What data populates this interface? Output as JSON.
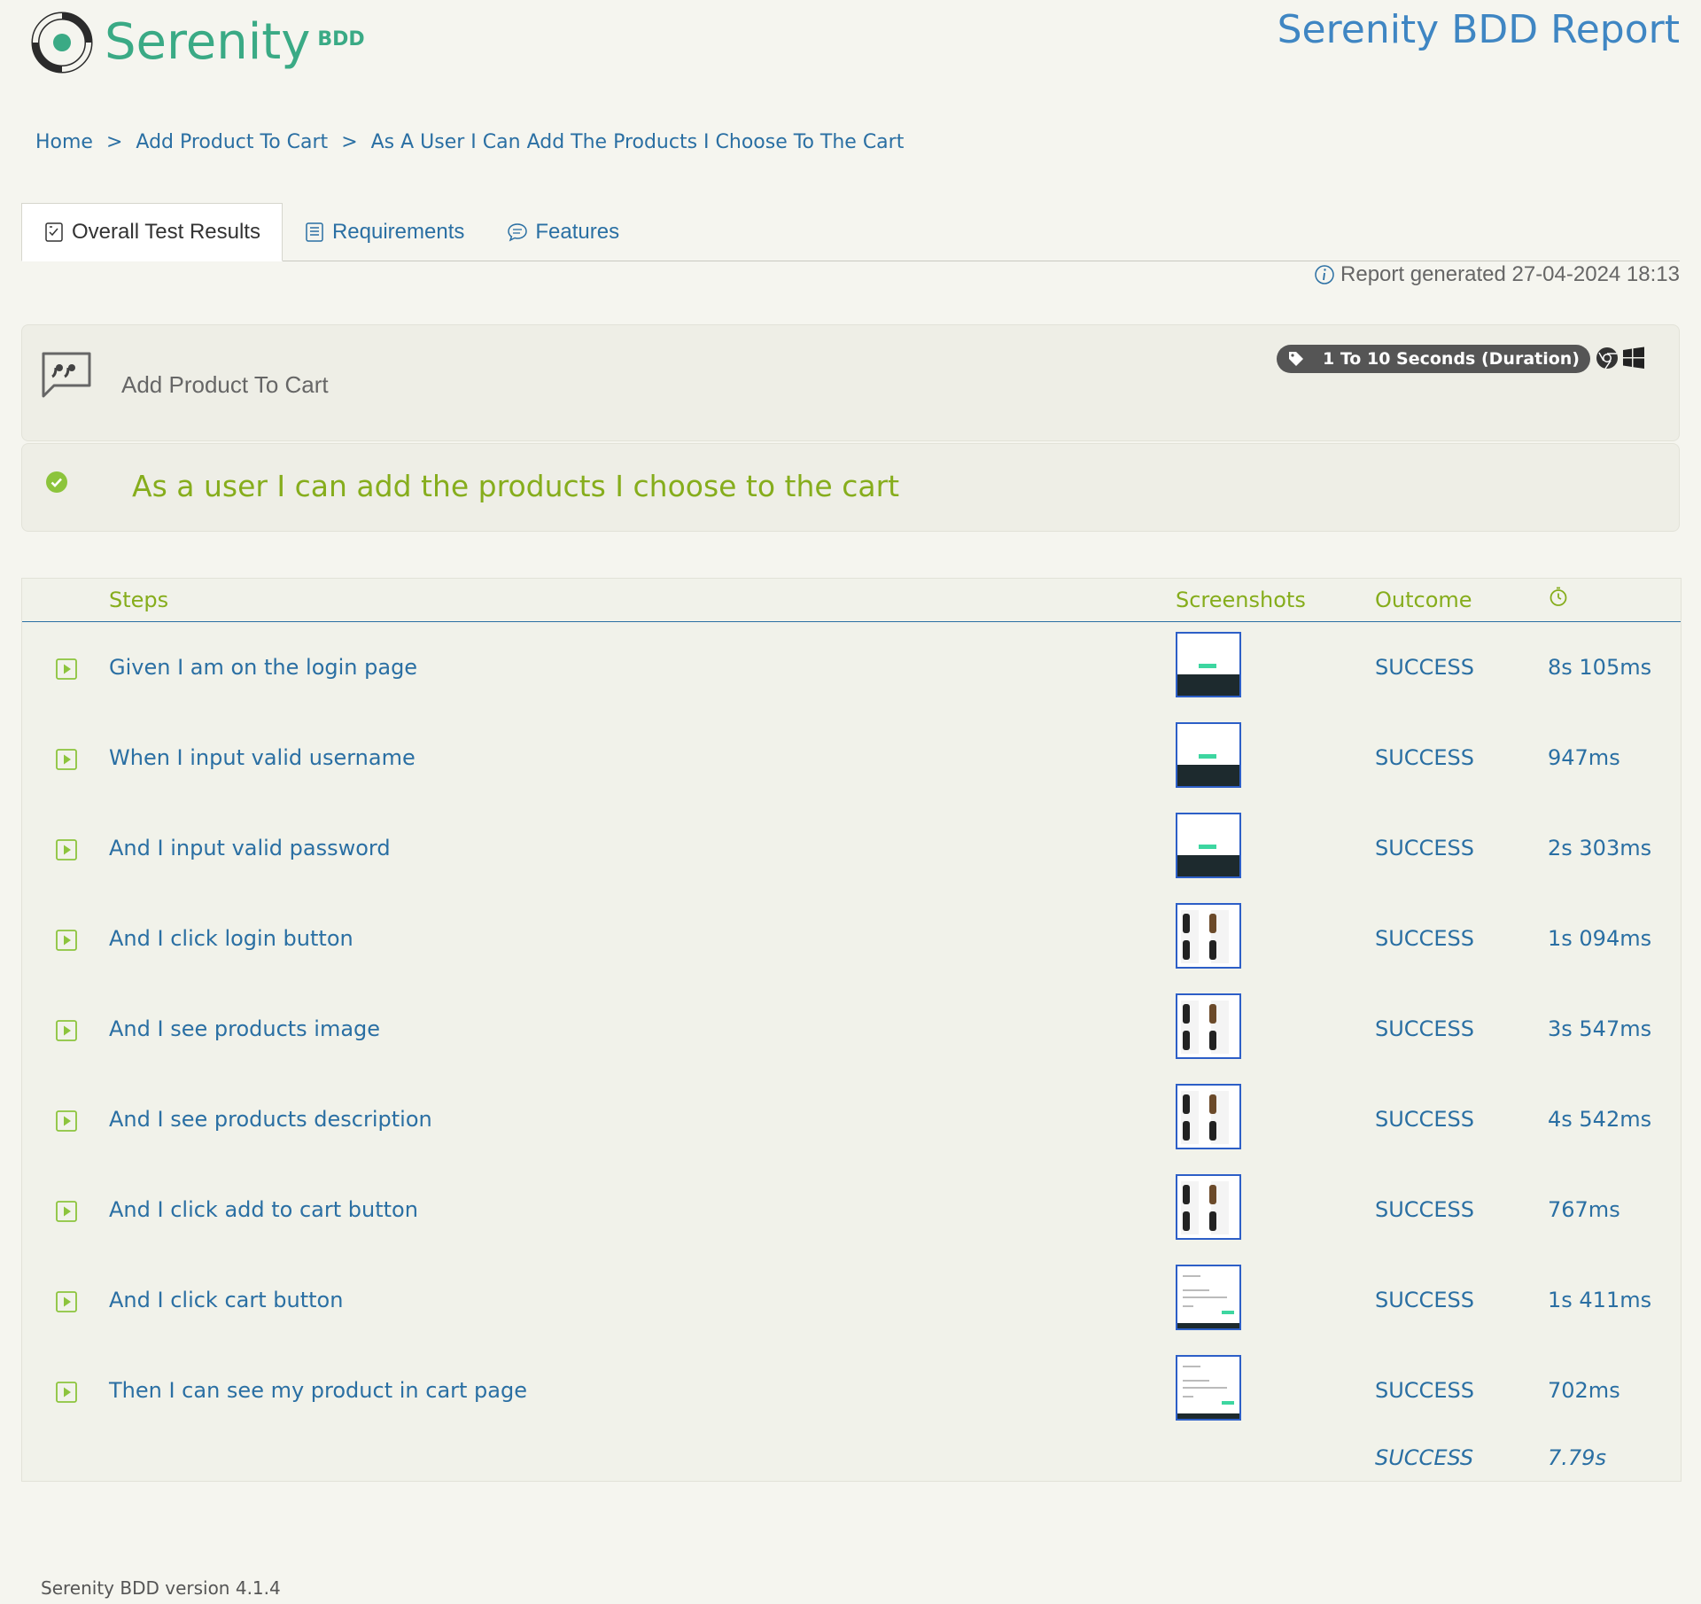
{
  "header": {
    "logo_text": "Serenity",
    "logo_sub": "BDD",
    "report_title": "Serenity BDD Report"
  },
  "breadcrumb": {
    "home": "Home",
    "sep": ">",
    "feature": "Add Product To Cart",
    "scenario": "As A User I Can Add The Products I Choose To The Cart"
  },
  "tabs": [
    {
      "label": "Overall Test Results",
      "active": true
    },
    {
      "label": "Requirements",
      "active": false
    },
    {
      "label": "Features",
      "active": false
    }
  ],
  "report_generated": "Report generated 27-04-2024 18:13",
  "feature": {
    "name": "Add Product To Cart",
    "tag": "1 To 10 Seconds (Duration)"
  },
  "scenario": {
    "title": "As a user I can add the products I choose to the cart",
    "status": "success"
  },
  "table": {
    "headers": {
      "steps": "Steps",
      "screenshots": "Screenshots",
      "outcome": "Outcome",
      "duration_icon": "stopwatch-icon"
    },
    "rows": [
      {
        "step": "Given I am on the login page",
        "outcome": "SUCCESS",
        "duration": "8s 105ms",
        "thumb": "login"
      },
      {
        "step": "When I input valid username",
        "outcome": "SUCCESS",
        "duration": "947ms",
        "thumb": "login"
      },
      {
        "step": "And I input valid password",
        "outcome": "SUCCESS",
        "duration": "2s 303ms",
        "thumb": "login"
      },
      {
        "step": "And I click login button",
        "outcome": "SUCCESS",
        "duration": "1s 094ms",
        "thumb": "products"
      },
      {
        "step": "And I see products image",
        "outcome": "SUCCESS",
        "duration": "3s 547ms",
        "thumb": "products"
      },
      {
        "step": "And I see products description",
        "outcome": "SUCCESS",
        "duration": "4s 542ms",
        "thumb": "products"
      },
      {
        "step": "And I click add to cart button",
        "outcome": "SUCCESS",
        "duration": "767ms",
        "thumb": "products"
      },
      {
        "step": "And I click cart button",
        "outcome": "SUCCESS",
        "duration": "1s 411ms",
        "thumb": "cart"
      },
      {
        "step": "Then I can see my product in cart page",
        "outcome": "SUCCESS",
        "duration": "702ms",
        "thumb": "cart"
      }
    ],
    "total": {
      "outcome": "SUCCESS",
      "duration": "7.79s"
    }
  },
  "footer": "Serenity BDD version 4.1.4",
  "colors": {
    "accent_green": "#86ad1c",
    "link_blue": "#2a6fa3",
    "brand_teal": "#3aaa85"
  }
}
